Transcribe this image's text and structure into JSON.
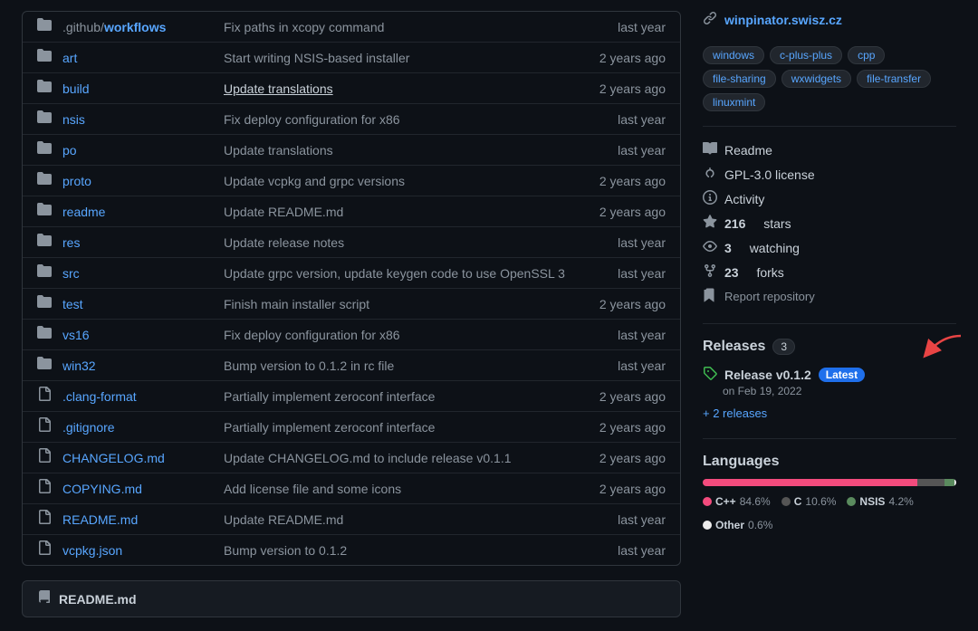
{
  "files": [
    {
      "type": "folder",
      "name": ".github/workflows",
      "name_bold": ".github/",
      "name_bold_part": "workflows",
      "commit": "Fix paths in xcopy command",
      "time": "last year"
    },
    {
      "type": "folder",
      "name": "art",
      "commit": "Start writing NSIS-based installer",
      "time": "2 years ago"
    },
    {
      "type": "folder",
      "name": "build",
      "commit": "Update translations",
      "commit_link": true,
      "time": "2 years ago"
    },
    {
      "type": "folder",
      "name": "nsis",
      "commit": "Fix deploy configuration for x86",
      "time": "last year"
    },
    {
      "type": "folder",
      "name": "po",
      "commit": "Update translations",
      "time": "last year"
    },
    {
      "type": "folder",
      "name": "proto",
      "commit": "Update vcpkg and grpc versions",
      "time": "2 years ago"
    },
    {
      "type": "folder",
      "name": "readme",
      "commit": "Update README.md",
      "time": "2 years ago"
    },
    {
      "type": "folder",
      "name": "res",
      "commit": "Update release notes",
      "time": "last year"
    },
    {
      "type": "folder",
      "name": "src",
      "commit": "Update grpc version, update keygen code to use OpenSSL 3",
      "time": "last year"
    },
    {
      "type": "folder",
      "name": "test",
      "commit": "Finish main installer script",
      "time": "2 years ago"
    },
    {
      "type": "folder",
      "name": "vs16",
      "commit": "Fix deploy configuration for x86",
      "time": "last year"
    },
    {
      "type": "folder",
      "name": "win32",
      "commit": "Bump version to 0.1.2 in rc file",
      "time": "last year"
    },
    {
      "type": "file",
      "name": ".clang-format",
      "commit": "Partially implement zeroconf interface",
      "time": "2 years ago"
    },
    {
      "type": "file",
      "name": ".gitignore",
      "commit": "Partially implement zeroconf interface",
      "time": "2 years ago"
    },
    {
      "type": "file",
      "name": "CHANGELOG.md",
      "commit": "Update CHANGELOG.md to include release v0.1.1",
      "time": "2 years ago"
    },
    {
      "type": "file",
      "name": "COPYING.md",
      "commit": "Add license file and some icons",
      "time": "2 years ago"
    },
    {
      "type": "file",
      "name": "README.md",
      "commit": "Update README.md",
      "time": "last year"
    },
    {
      "type": "file",
      "name": "vcpkg.json",
      "commit": "Bump version to 0.1.2",
      "time": "last year"
    }
  ],
  "readme_footer": {
    "label": "README.md"
  },
  "sidebar": {
    "website": "winpinator.swisz.cz",
    "tags": [
      "windows",
      "c-plus-plus",
      "cpp",
      "file-sharing",
      "wxwidgets",
      "file-transfer",
      "linuxmint"
    ],
    "readme_label": "Readme",
    "license_label": "GPL-3.0 license",
    "activity_label": "Activity",
    "stars_count": "216",
    "stars_label": "stars",
    "watching_count": "3",
    "watching_label": "watching",
    "forks_count": "23",
    "forks_label": "forks",
    "report_label": "Report repository",
    "releases_title": "Releases",
    "releases_count": "3",
    "release_name": "Release v0.1.2",
    "release_badge": "Latest",
    "release_date": "on Feb 19, 2022",
    "more_releases": "+ 2 releases",
    "languages_title": "Languages",
    "languages": [
      {
        "name": "C++",
        "pct": "84.6%",
        "color": "#f34b7d",
        "bar_pct": 84.6
      },
      {
        "name": "C",
        "pct": "10.6%",
        "color": "#555555",
        "bar_pct": 10.6
      },
      {
        "name": "NSIS",
        "pct": "4.2%",
        "color": "#5a8b5e",
        "bar_pct": 4.2
      },
      {
        "name": "Other",
        "pct": "0.6%",
        "color": "#ededed",
        "bar_pct": 0.6
      }
    ]
  }
}
